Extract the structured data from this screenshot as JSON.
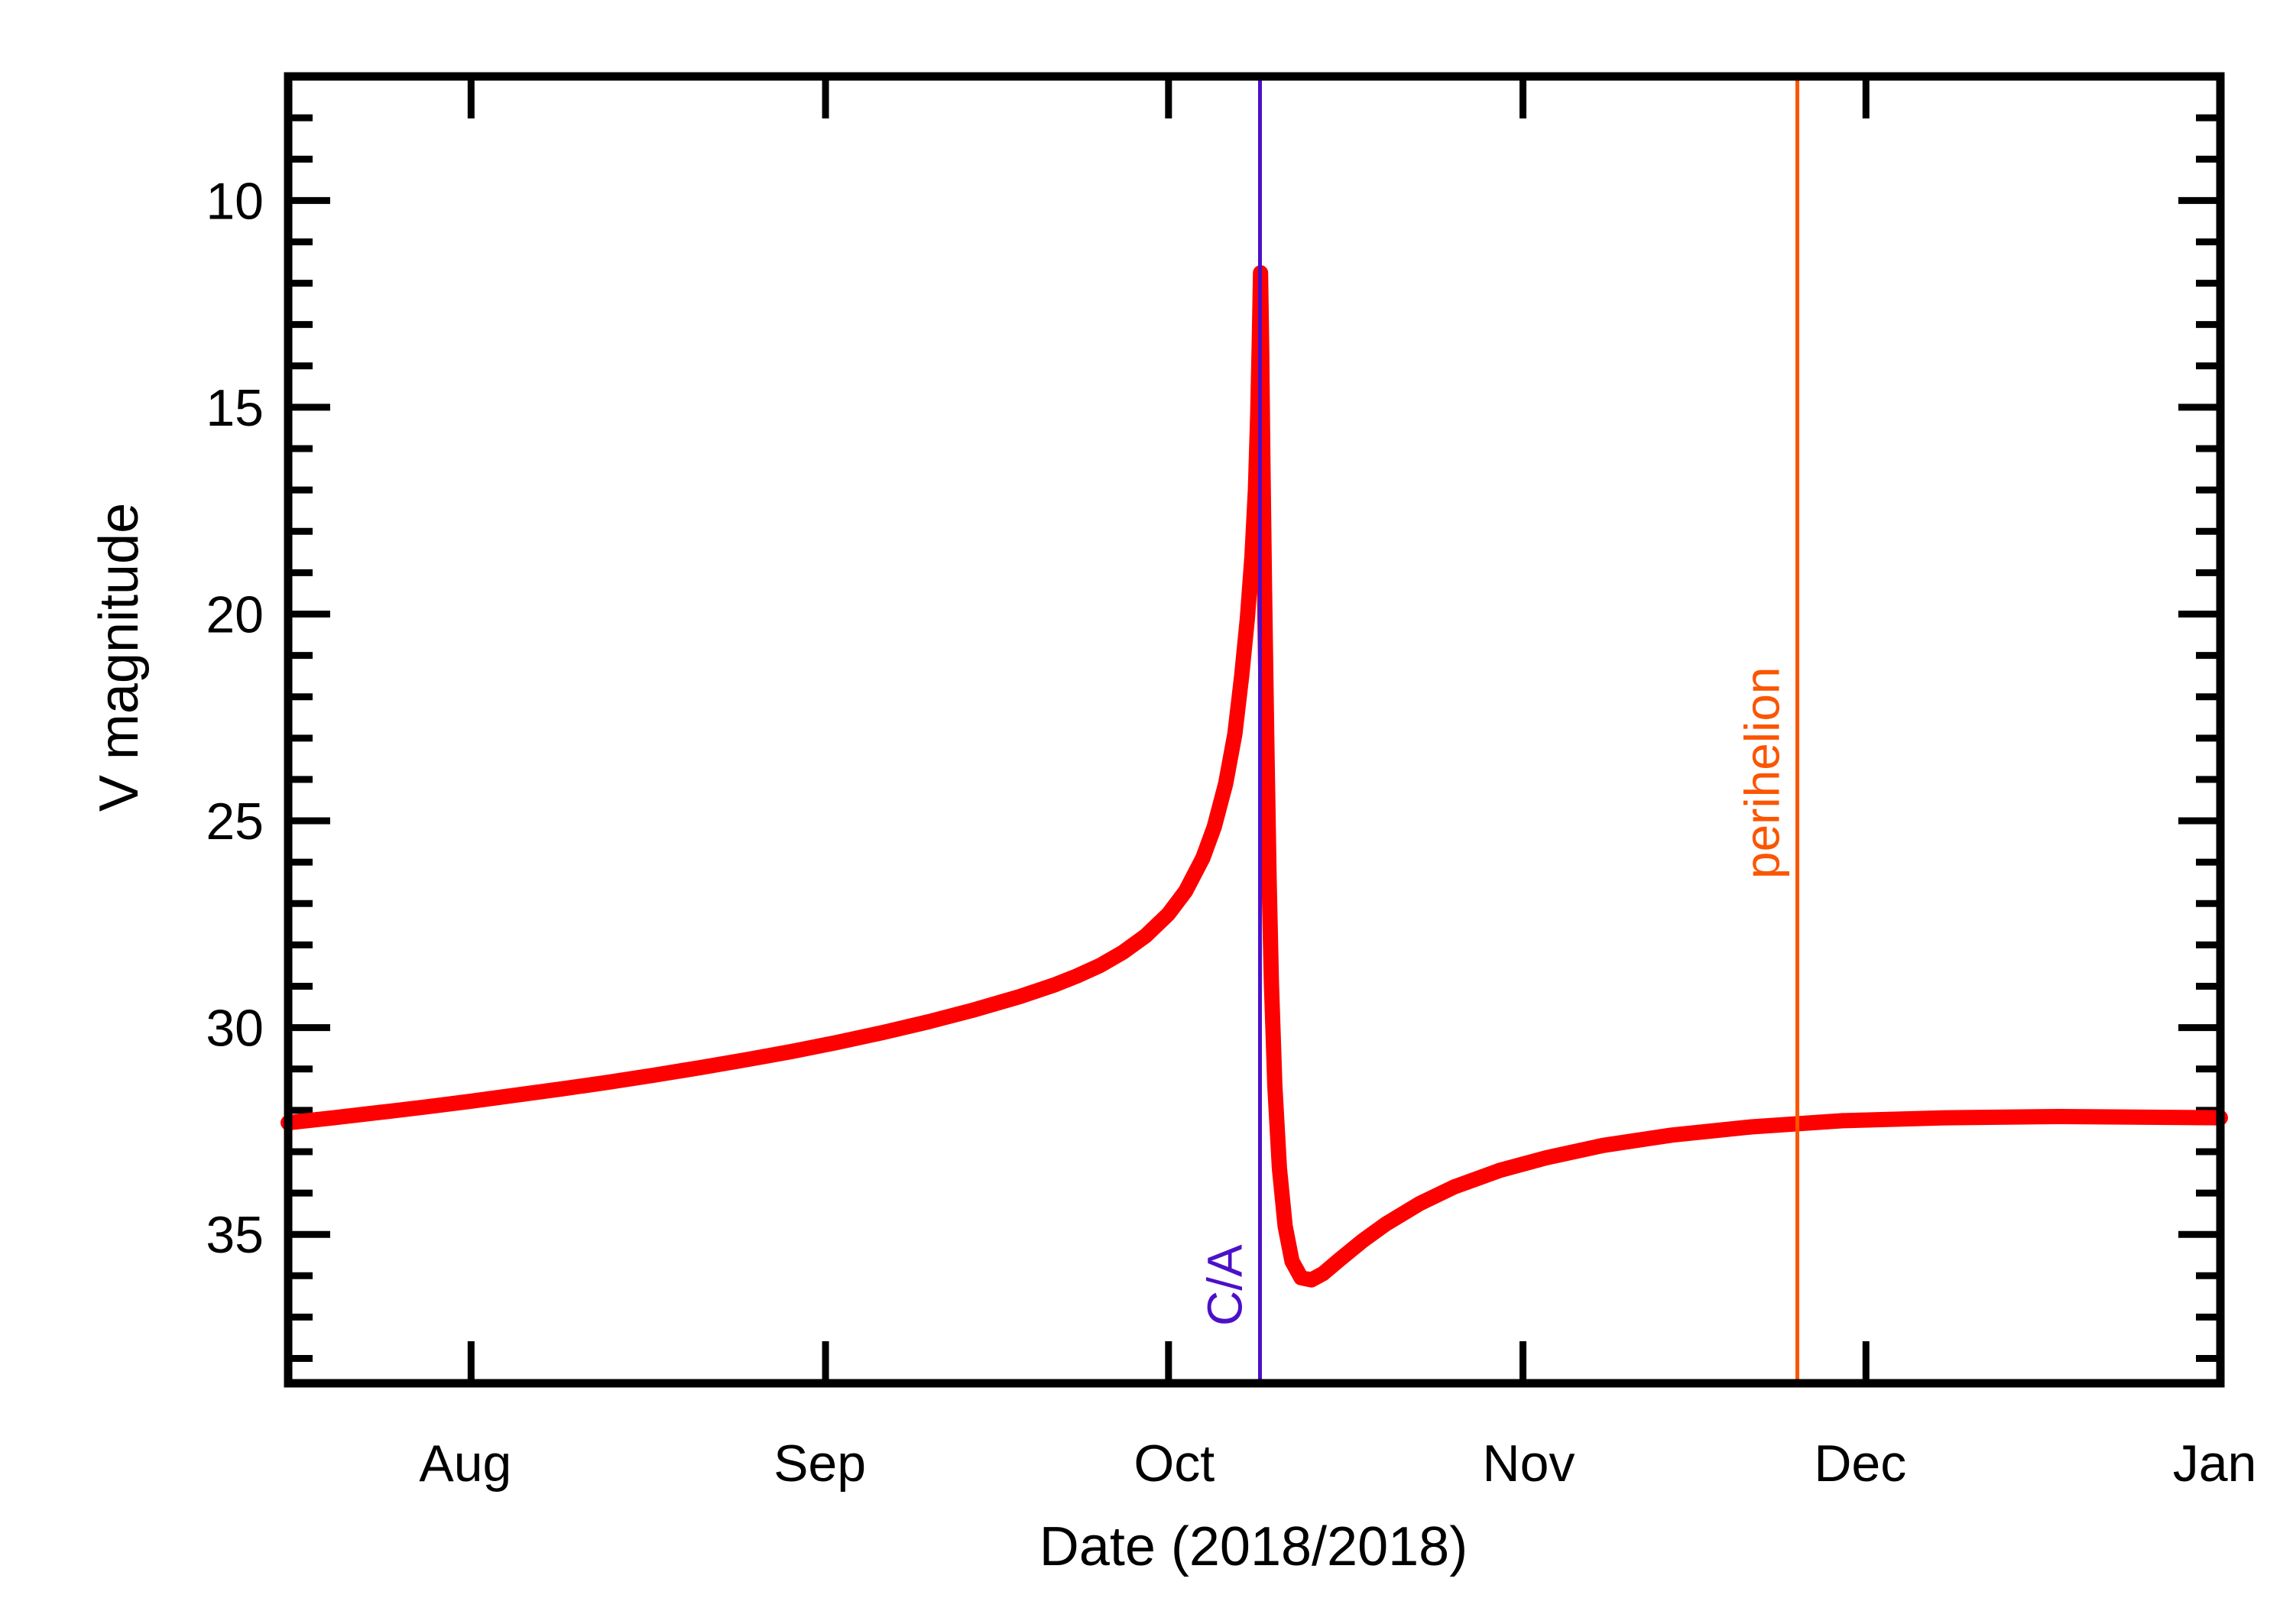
{
  "chart_data": {
    "type": "line",
    "title": "",
    "xlabel": "Date (2018/2018)",
    "ylabel": "V magnitude",
    "y_inverted": true,
    "ylim": [
      38.6,
      7.0
    ],
    "y_ticks_major": [
      10,
      15,
      20,
      25,
      30,
      35
    ],
    "y_tick_labels": [
      "10",
      "15",
      "20",
      "25",
      "30",
      "35"
    ],
    "y_minor_step": 1,
    "grid": false,
    "legend": false,
    "x_axis_type": "date",
    "x_range_days": [
      197,
      366
    ],
    "x_tick_labels": [
      "Aug",
      "Sep",
      "Oct",
      "Nov",
      "Dec",
      "Jan"
    ],
    "x_tick_label_days": [
      212.5,
      243.5,
      274.5,
      305.5,
      334.5,
      365.5
    ],
    "x_tick_boundary_days": [
      213,
      244,
      274,
      305,
      335,
      366
    ],
    "series": [
      {
        "name": "V magnitude",
        "color": "#fe0000",
        "points": [
          [
            197.0,
            32.3
          ],
          [
            201.0,
            32.18
          ],
          [
            205.0,
            32.05
          ],
          [
            209.0,
            31.92
          ],
          [
            213.0,
            31.78
          ],
          [
            217.0,
            31.63
          ],
          [
            221.0,
            31.48
          ],
          [
            225.0,
            31.32
          ],
          [
            229.0,
            31.15
          ],
          [
            233.0,
            30.97
          ],
          [
            237.0,
            30.78
          ],
          [
            241.0,
            30.58
          ],
          [
            245.0,
            30.36
          ],
          [
            249.0,
            30.12
          ],
          [
            253.0,
            29.86
          ],
          [
            257.0,
            29.57
          ],
          [
            261.0,
            29.25
          ],
          [
            264.0,
            28.97
          ],
          [
            266.0,
            28.75
          ],
          [
            268.0,
            28.5
          ],
          [
            270.0,
            28.18
          ],
          [
            272.0,
            27.78
          ],
          [
            274.0,
            27.25
          ],
          [
            275.5,
            26.7
          ],
          [
            277.0,
            25.9
          ],
          [
            278.0,
            25.15
          ],
          [
            279.0,
            24.1
          ],
          [
            279.8,
            22.9
          ],
          [
            280.4,
            21.5
          ],
          [
            280.9,
            20.1
          ],
          [
            281.3,
            18.6
          ],
          [
            281.6,
            17.0
          ],
          [
            281.8,
            15.2
          ],
          [
            281.95,
            13.3
          ],
          [
            282.05,
            11.75
          ],
          [
            282.15,
            13.6
          ],
          [
            282.25,
            16.2
          ],
          [
            282.4,
            19.5
          ],
          [
            282.6,
            23.2
          ],
          [
            282.8,
            26.4
          ],
          [
            283.0,
            28.9
          ],
          [
            283.3,
            31.4
          ],
          [
            283.7,
            33.4
          ],
          [
            284.2,
            34.8
          ],
          [
            284.8,
            35.65
          ],
          [
            285.6,
            36.05
          ],
          [
            286.5,
            36.1
          ],
          [
            287.5,
            35.95
          ],
          [
            289.0,
            35.6
          ],
          [
            291.0,
            35.15
          ],
          [
            293.0,
            34.75
          ],
          [
            296.0,
            34.25
          ],
          [
            299.0,
            33.85
          ],
          [
            303.0,
            33.45
          ],
          [
            307.0,
            33.15
          ],
          [
            312.0,
            32.85
          ],
          [
            318.0,
            32.6
          ],
          [
            325.0,
            32.4
          ],
          [
            333.0,
            32.25
          ],
          [
            342.0,
            32.18
          ],
          [
            352.0,
            32.15
          ],
          [
            366.0,
            32.18
          ]
        ]
      }
    ],
    "annotations": [
      {
        "name": "close-approach",
        "label": "C/A",
        "day": 282.0,
        "color": "#4b10c8",
        "orientation": "vertical",
        "text_rotation": -90
      },
      {
        "name": "perihelion",
        "label": "perihelion",
        "day": 329.0,
        "color": "#fb5500",
        "orientation": "vertical",
        "text_rotation": -90
      }
    ]
  },
  "axes": {
    "y_label": "V magnitude",
    "x_label": "Date (2018/2018)"
  },
  "colors": {
    "curve": "#fe0000",
    "close_approach": "#4b10c8",
    "perihelion": "#fb5500",
    "axis": "#000000",
    "background": "#ffffff"
  }
}
